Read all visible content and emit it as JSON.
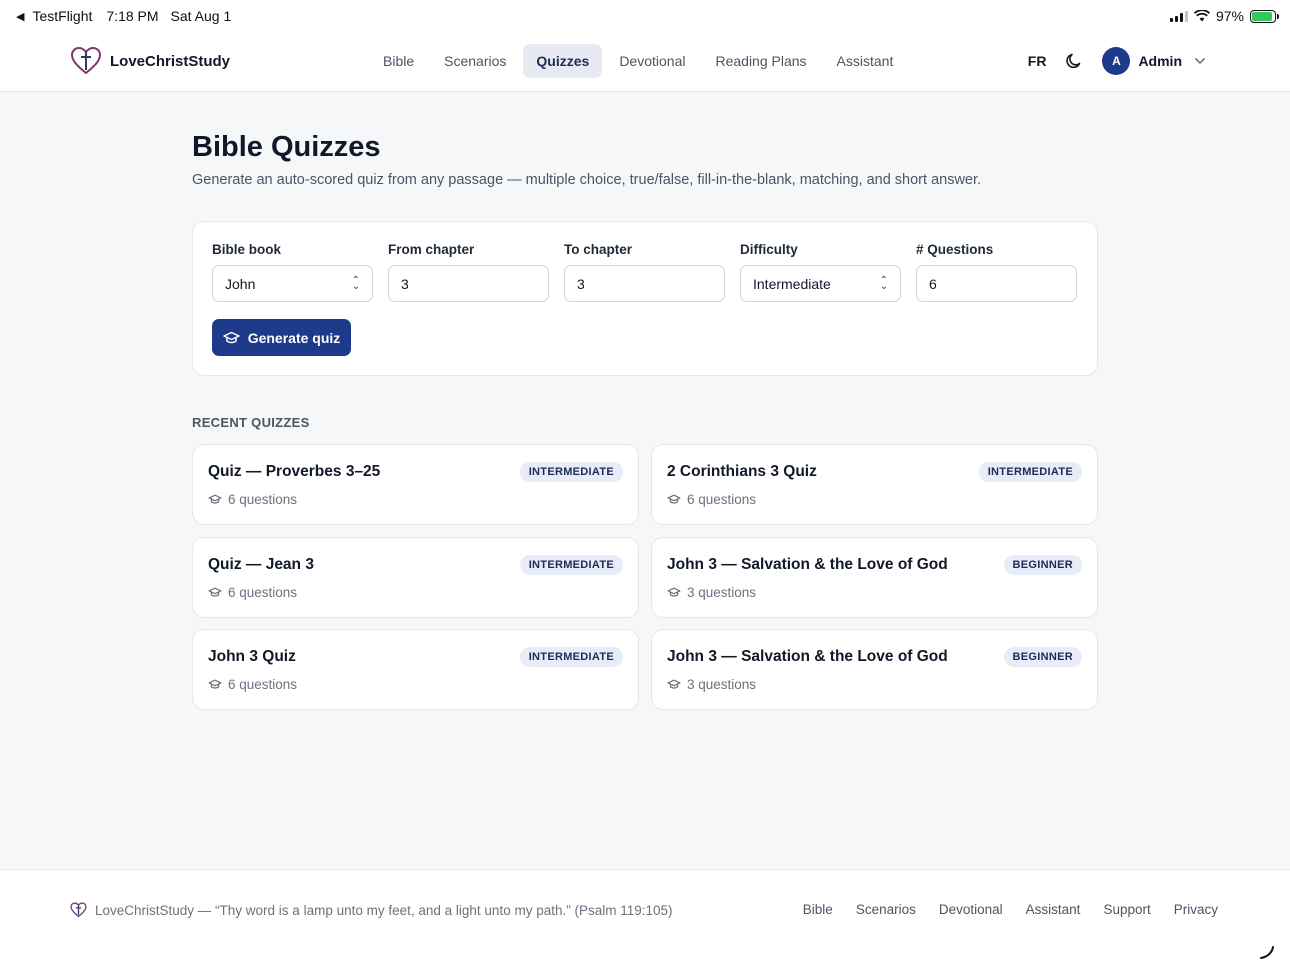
{
  "statusbar": {
    "back_app": "TestFlight",
    "time": "7:18 PM",
    "date": "Sat Aug 1",
    "battery": "97%"
  },
  "header": {
    "brand": "LoveChristStudy",
    "nav": [
      "Bible",
      "Scenarios",
      "Quizzes",
      "Devotional",
      "Reading Plans",
      "Assistant"
    ],
    "active_nav": "Quizzes",
    "lang": "FR",
    "avatar_initial": "A",
    "user": "Admin"
  },
  "page": {
    "title": "Bible Quizzes",
    "subtitle": "Generate an auto-scored quiz from any passage — multiple choice, true/false, fill-in-the-blank, matching, and short answer."
  },
  "form": {
    "book_label": "Bible book",
    "book_value": "John",
    "from_label": "From chapter",
    "from_value": "3",
    "to_label": "To chapter",
    "to_value": "3",
    "difficulty_label": "Difficulty",
    "difficulty_value": "Intermediate",
    "questions_label": "# Questions",
    "questions_value": "6",
    "generate_label": "Generate quiz"
  },
  "recent": {
    "label": "RECENT QUIZZES",
    "items": [
      {
        "title": "Quiz — Proverbes 3–25",
        "level": "INTERMEDIATE",
        "count": "6 questions"
      },
      {
        "title": "2 Corinthians 3 Quiz",
        "level": "INTERMEDIATE",
        "count": "6 questions"
      },
      {
        "title": "Quiz — Jean 3",
        "level": "INTERMEDIATE",
        "count": "6 questions"
      },
      {
        "title": "John 3 — Salvation & the Love of God",
        "level": "BEGINNER",
        "count": "3 questions"
      },
      {
        "title": "John 3 Quiz",
        "level": "INTERMEDIATE",
        "count": "6 questions"
      },
      {
        "title": "John 3 — Salvation & the Love of God",
        "level": "BEGINNER",
        "count": "3 questions"
      }
    ]
  },
  "footer": {
    "quote": "LoveChristStudy — “Thy word is a lamp unto my feet, and a light unto my path.” (Psalm 119:105)",
    "links": [
      "Bible",
      "Scenarios",
      "Devotional",
      "Assistant",
      "Support",
      "Privacy"
    ]
  },
  "colors": {
    "accent": "#1e3a8a",
    "badge_bg": "#e8ecf6",
    "brand_icon": "#7c3a6b"
  },
  "icons": {
    "brand": "heart-cross-icon",
    "theme": "moon-icon",
    "user_menu": "chevron-down-icon",
    "generate": "graduation-cap-icon",
    "questions": "graduation-cap-icon"
  }
}
